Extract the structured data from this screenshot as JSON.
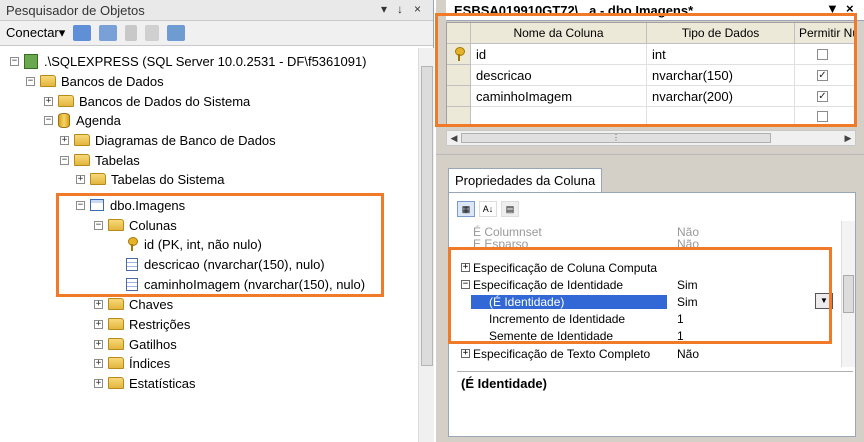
{
  "object_explorer": {
    "title": "Pesquisador de Objetos",
    "pin": "↓",
    "close": "×",
    "menu": "▾",
    "connect_label": "Conectar▾",
    "tree": {
      "server": ".\\SQLEXPRESS (SQL Server 10.0.2531 - DF\\f5361091)",
      "databases": "Bancos de Dados",
      "system_dbs": "Bancos de Dados do Sistema",
      "agenda": "Agenda",
      "diagrams": "Diagramas de Banco de Dados",
      "tables": "Tabelas",
      "system_tables": "Tabelas do Sistema",
      "table": "dbo.Imagens",
      "columns": "Colunas",
      "col1": "id (PK, int, não nulo)",
      "col2": "descricao (nvarchar(150), nulo)",
      "col3": "caminhoImagem (nvarchar(150), nulo)",
      "keys": "Chaves",
      "constraints": "Restrições",
      "triggers": "Gatilhos",
      "indexes": "Índices",
      "statistics": "Estatísticas"
    }
  },
  "designer": {
    "tab_title": "ESBSA019910GT72\\...a - dbo.Imagens*",
    "close": "×",
    "headers": [
      "Nome da Coluna",
      "Tipo de Dados",
      "Permitir Nulos"
    ],
    "rows": [
      {
        "name": "id",
        "type": "int",
        "nullable": false
      },
      {
        "name": "descricao",
        "type": "nvarchar(150)",
        "nullable": true
      },
      {
        "name": "caminhoImagem",
        "type": "nvarchar(200)",
        "nullable": true
      }
    ]
  },
  "properties": {
    "tab": "Propriedades da Coluna",
    "rows": {
      "columnset": {
        "name": "É Columnset",
        "value": "Não"
      },
      "sparse": {
        "name": "É Esparso",
        "value": "Não"
      },
      "computed": {
        "name": "Especificação de Coluna Computa",
        "value": ""
      },
      "identity_spec": {
        "name": "Especificação de Identidade",
        "value": "Sim"
      },
      "is_identity": {
        "name": "(É Identidade)",
        "value": "Sim"
      },
      "increment": {
        "name": "Incremento de Identidade",
        "value": "1"
      },
      "seed": {
        "name": "Semente de Identidade",
        "value": "1"
      },
      "fulltext": {
        "name": "Especificação de Texto Completo",
        "value": "Não"
      }
    },
    "description": "(É Identidade)"
  },
  "highlight_color": "#f07a28"
}
